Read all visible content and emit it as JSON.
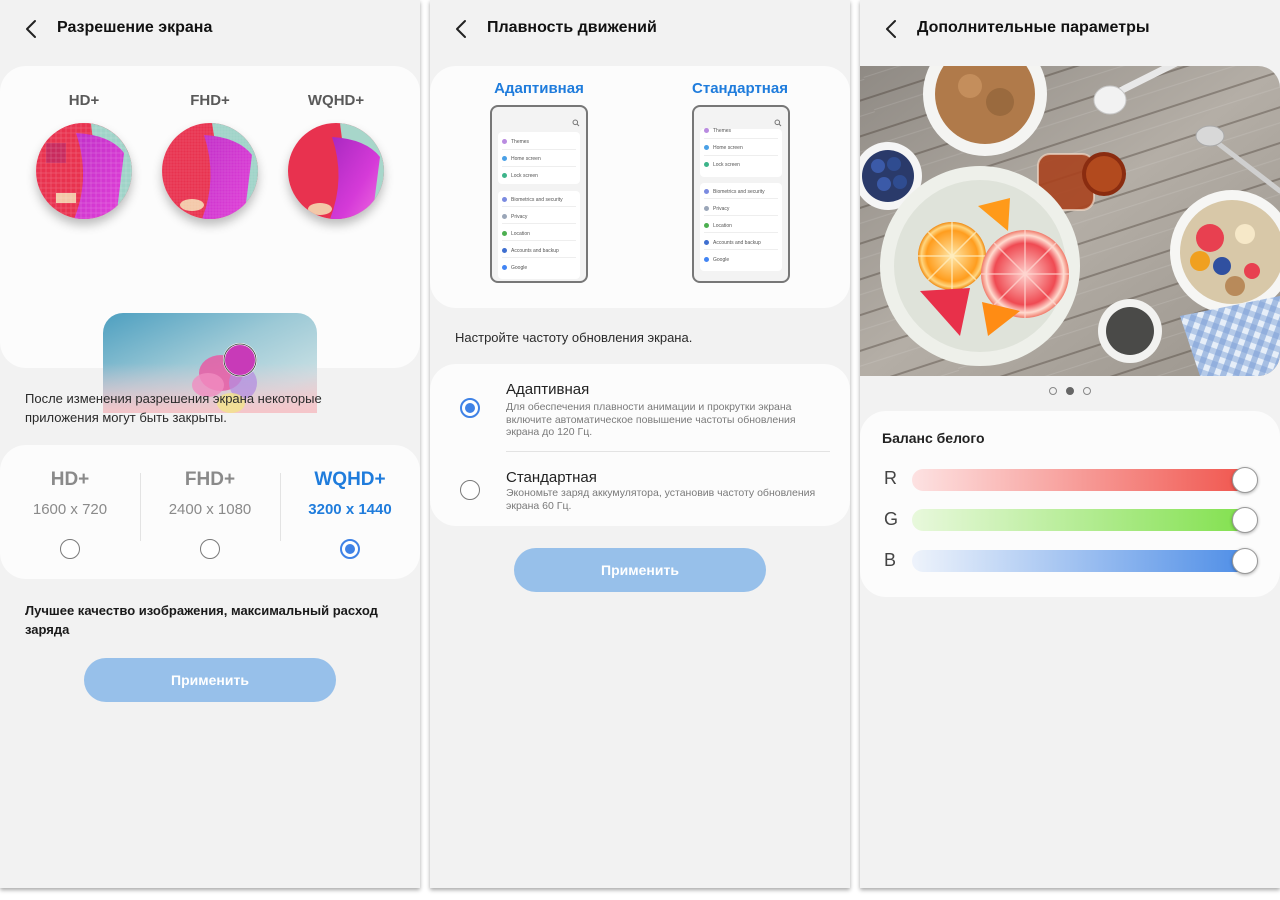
{
  "resolution": {
    "title": "Разрешение экрана",
    "zoom_labels": [
      "HD+",
      "FHD+",
      "WQHD+"
    ],
    "note": "После изменения разрешения экрана некоторые приложения могут быть закрыты.",
    "options": [
      {
        "name": "HD+",
        "size": "1600 x 720",
        "selected": false
      },
      {
        "name": "FHD+",
        "size": "2400 x 1080",
        "selected": false
      },
      {
        "name": "WQHD+",
        "size": "3200 x 1440",
        "selected": true
      }
    ],
    "quality_text": "Лучшее качество изображения, максимальный расход заряда",
    "apply_label": "Применить"
  },
  "motion": {
    "title": "Плавность движений",
    "preview_labels": [
      "Адаптивная",
      "Стандартная"
    ],
    "phone_items_group1": [
      "Themes",
      "Home screen",
      "Lock screen"
    ],
    "phone_items_group2": [
      "Biometrics and security",
      "Privacy",
      "Location",
      "Accounts and backup",
      "Google"
    ],
    "phone_item_colors": [
      "#b98be0",
      "#4aa0e6",
      "#3db48a",
      "#7b8be0",
      "#9aa6b8",
      "#4caf50",
      "#3f6fd0",
      "#4285f4"
    ],
    "instruction": "Настройте частоту обновления экрана.",
    "options": [
      {
        "title": "Адаптивная",
        "desc": "Для обеспечения плавности анимации и прокрутки экрана включите автоматическое повышение частоты обновления экрана до 120 Гц.",
        "selected": true
      },
      {
        "title": "Стандартная",
        "desc": "Экономьте заряд аккумулятора, установив частоту обновления экрана 60 Гц.",
        "selected": false
      }
    ],
    "apply_label": "Применить"
  },
  "advanced": {
    "title": "Дополнительные параметры",
    "page_dots": {
      "count": 3,
      "active": 2
    },
    "white_balance_title": "Баланс белого",
    "sliders": [
      {
        "label": "R",
        "value": 1.0,
        "color": "#f0524a"
      },
      {
        "label": "G",
        "value": 1.0,
        "color": "#7fe04a"
      },
      {
        "label": "B",
        "value": 1.0,
        "color": "#4a8be6"
      }
    ]
  },
  "colors": {
    "accent": "#1f7cdc",
    "button": "#97c0ea",
    "radio": "#3f82e6",
    "background": "#f2f2f2",
    "card": "#fcfcfc"
  }
}
